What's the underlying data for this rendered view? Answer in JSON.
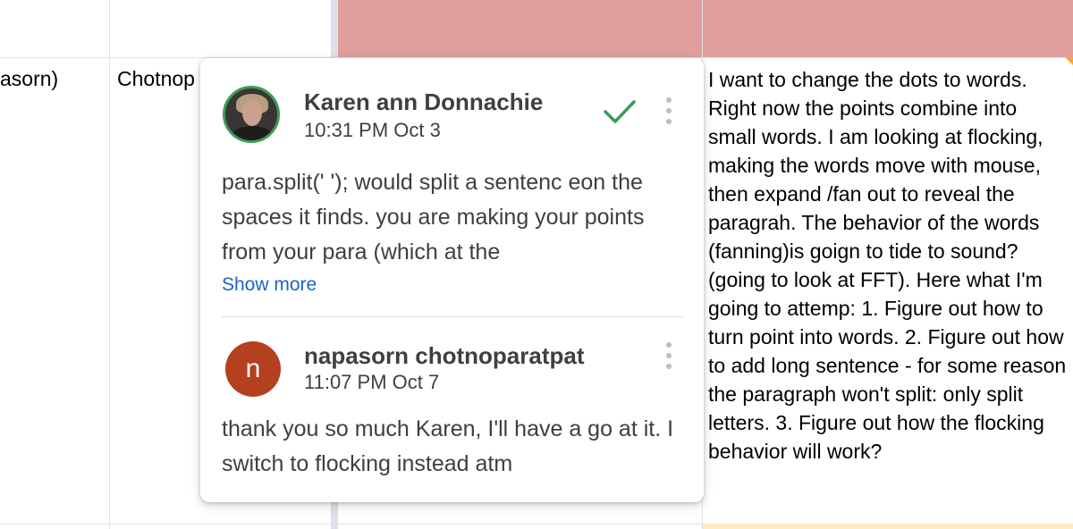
{
  "sheet": {
    "cell_left_partial": "asorn)",
    "cell_name_partial": "Chotnop",
    "note_text": "I want to change the dots to words. Right now the points combine into small words. I am looking at flocking, making the words move with mouse, then expand /fan out to reveal the paragrah. The behavior of the words (fanning)is goign to tide to sound?(going to look at FFT). Here what I'm going to attemp: 1. Figure out how to turn point into words. 2. Figure out how to add long sentence - for some reason the paragraph won't split: only split letters. 3. Figure out how the flocking behavior will work?",
    "colors": {
      "header_fill": "#e09e9c",
      "note_marker": "#f9a825"
    }
  },
  "comment_thread": {
    "comments": [
      {
        "author": "Karen ann Donnachie",
        "time": "10:31 PM Oct 3",
        "text": "para.split(' '); would split a sentenc eon the spaces it finds. you are making your points from your para (which at the",
        "show_more": "Show more",
        "avatar_icon": "profile-photo",
        "resolve_icon": "check-icon",
        "menu_icon": "more-vert-icon"
      },
      {
        "author": "napasorn chotnoparatpat",
        "time": "11:07 PM Oct 7",
        "text": "thank you so much Karen, I'll have a go at it. I switch to flocking instead atm",
        "avatar_letter": "n",
        "avatar_color": "#b5401f",
        "menu_icon": "more-vert-icon"
      }
    ]
  }
}
